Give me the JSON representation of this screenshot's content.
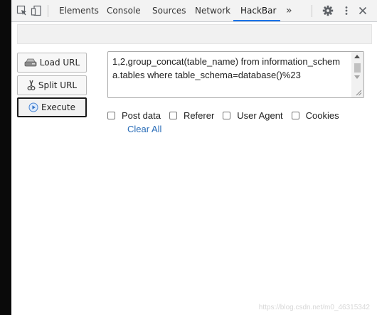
{
  "devtools": {
    "tabs": [
      {
        "label": "Elements"
      },
      {
        "label": "Console"
      },
      {
        "label": "Sources"
      },
      {
        "label": "Network"
      },
      {
        "label": "HackBar",
        "active": true
      }
    ],
    "more_label": "»",
    "icons": {
      "inspect": "cursor-inspect-icon",
      "device": "device-toggle-icon",
      "settings": "gear-icon",
      "menu": "kebab-menu-icon",
      "close": "close-icon"
    },
    "accent_color": "#1a73e8"
  },
  "hackbar": {
    "buttons": {
      "load_url": "Load URL",
      "split_url": "Split URL",
      "execute": "Execute"
    },
    "url_value": "1,2,group_concat(table_name) from information_schema.tables where table_schema=database()%23",
    "options": {
      "post_data": "Post data",
      "referer": "Referer",
      "user_agent": "User Agent",
      "cookies": "Cookies"
    },
    "clear_all": "Clear All",
    "link_color": "#2a6db8"
  },
  "watermark": "https://blog.csdn.net/m0_46315342"
}
